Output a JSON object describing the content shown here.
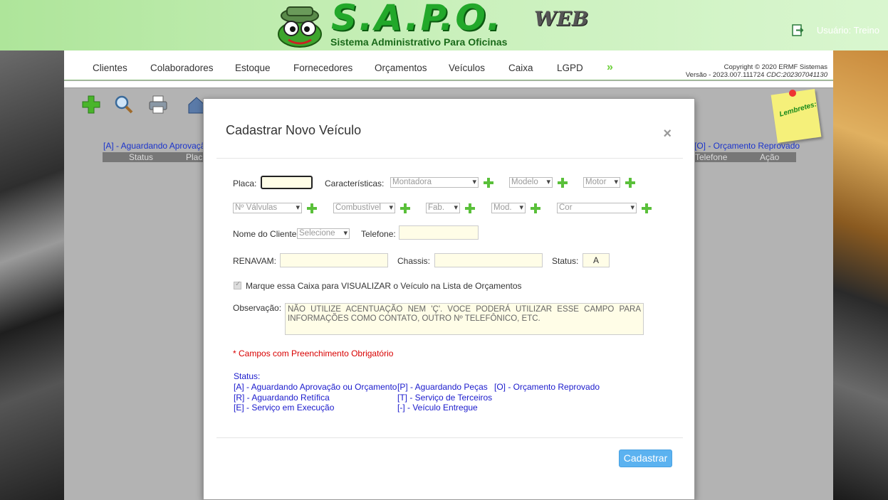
{
  "header": {
    "logo_title": "S.A.P.O.",
    "logo_web": "WEB",
    "logo_subtitle": "Sistema Administrativo Para Oficinas",
    "user_label": "Usuário: Treino"
  },
  "nav": {
    "items": [
      "Clientes",
      "Colaboradores",
      "Estoque",
      "Fornecedores",
      "Orçamentos",
      "Veículos",
      "Caixa",
      "LGPD"
    ],
    "more": "»",
    "copyright": "Copyright © 2020 ERMF Sistemas",
    "version": "Versão - 2023.007.111724",
    "cdc": "CDC:202307041130"
  },
  "background": {
    "legend_left": "[A] - Aguardando Aprovaçã",
    "legend_right": "[O] - Orçamento Reprovado",
    "col_status": "Status",
    "col_placa": "Placa",
    "col_telefone": "Telefone",
    "col_acao": "Ação",
    "sticky_note": "Lembretes:"
  },
  "modal": {
    "title": "Cadastrar Novo Veículo",
    "close": "×",
    "placa_label": "Placa:",
    "placa_value": "",
    "caracteristicas_label": "Características:",
    "montadora": "Montadora",
    "modelo": "Modelo",
    "motor": "Motor",
    "valvulas": "Nº Válvulas",
    "combustivel": "Combustível",
    "fab": "Fab.",
    "mod": "Mod.",
    "cor": "Cor",
    "cliente_label": "Nome do Cliente",
    "cliente_select": "Selecione",
    "telefone_label": "Telefone:",
    "telefone_value": "",
    "renavam_label": "RENAVAM:",
    "renavam_value": "",
    "chassis_label": "Chassis:",
    "chassis_value": "",
    "status_label": "Status:",
    "status_value": "A",
    "checkbox_label": "Marque essa Caixa para VISUALIZAR o Veículo na Lista de Orçamentos",
    "obs_label": "Observação:",
    "obs_text": "NÃO UTILIZE ACENTUAÇÃO NEM 'Ç'. VOCE PODERÁ UTILIZAR ESSE CAMPO PARA INFORMAÇÕES COMO CONTATO, OUTRO Nº TELEFÔNICO, ETC.",
    "required_note": "* Campos com Preenchimento Obrigatório",
    "status_title": "Status:",
    "status_legend": {
      "a": "[A] - Aguardando Aprovação ou Orçamento",
      "p": "[P] - Aguardando Peças",
      "o": "[O] - Orçamento Reprovado",
      "r": "[R] - Aguardando Retífica",
      "t": "[T] - Serviço de Terceiros",
      "e": "[E] - Serviço em Execução",
      "v": "[-] - Veículo Entregue"
    },
    "submit": "Cadastrar"
  }
}
